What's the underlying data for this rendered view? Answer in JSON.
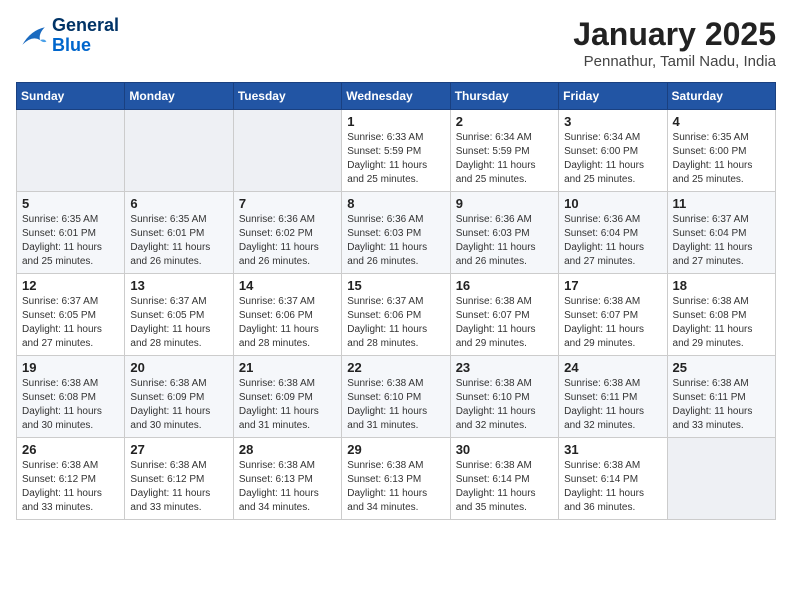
{
  "logo": {
    "line1": "General",
    "line2": "Blue"
  },
  "calendar": {
    "title": "January 2025",
    "subtitle": "Pennathur, Tamil Nadu, India"
  },
  "weekdays": [
    "Sunday",
    "Monday",
    "Tuesday",
    "Wednesday",
    "Thursday",
    "Friday",
    "Saturday"
  ],
  "weeks": [
    [
      {
        "day": "",
        "info": ""
      },
      {
        "day": "",
        "info": ""
      },
      {
        "day": "",
        "info": ""
      },
      {
        "day": "1",
        "info": "Sunrise: 6:33 AM\nSunset: 5:59 PM\nDaylight: 11 hours and 25 minutes."
      },
      {
        "day": "2",
        "info": "Sunrise: 6:34 AM\nSunset: 5:59 PM\nDaylight: 11 hours and 25 minutes."
      },
      {
        "day": "3",
        "info": "Sunrise: 6:34 AM\nSunset: 6:00 PM\nDaylight: 11 hours and 25 minutes."
      },
      {
        "day": "4",
        "info": "Sunrise: 6:35 AM\nSunset: 6:00 PM\nDaylight: 11 hours and 25 minutes."
      }
    ],
    [
      {
        "day": "5",
        "info": "Sunrise: 6:35 AM\nSunset: 6:01 PM\nDaylight: 11 hours and 25 minutes."
      },
      {
        "day": "6",
        "info": "Sunrise: 6:35 AM\nSunset: 6:01 PM\nDaylight: 11 hours and 26 minutes."
      },
      {
        "day": "7",
        "info": "Sunrise: 6:36 AM\nSunset: 6:02 PM\nDaylight: 11 hours and 26 minutes."
      },
      {
        "day": "8",
        "info": "Sunrise: 6:36 AM\nSunset: 6:03 PM\nDaylight: 11 hours and 26 minutes."
      },
      {
        "day": "9",
        "info": "Sunrise: 6:36 AM\nSunset: 6:03 PM\nDaylight: 11 hours and 26 minutes."
      },
      {
        "day": "10",
        "info": "Sunrise: 6:36 AM\nSunset: 6:04 PM\nDaylight: 11 hours and 27 minutes."
      },
      {
        "day": "11",
        "info": "Sunrise: 6:37 AM\nSunset: 6:04 PM\nDaylight: 11 hours and 27 minutes."
      }
    ],
    [
      {
        "day": "12",
        "info": "Sunrise: 6:37 AM\nSunset: 6:05 PM\nDaylight: 11 hours and 27 minutes."
      },
      {
        "day": "13",
        "info": "Sunrise: 6:37 AM\nSunset: 6:05 PM\nDaylight: 11 hours and 28 minutes."
      },
      {
        "day": "14",
        "info": "Sunrise: 6:37 AM\nSunset: 6:06 PM\nDaylight: 11 hours and 28 minutes."
      },
      {
        "day": "15",
        "info": "Sunrise: 6:37 AM\nSunset: 6:06 PM\nDaylight: 11 hours and 28 minutes."
      },
      {
        "day": "16",
        "info": "Sunrise: 6:38 AM\nSunset: 6:07 PM\nDaylight: 11 hours and 29 minutes."
      },
      {
        "day": "17",
        "info": "Sunrise: 6:38 AM\nSunset: 6:07 PM\nDaylight: 11 hours and 29 minutes."
      },
      {
        "day": "18",
        "info": "Sunrise: 6:38 AM\nSunset: 6:08 PM\nDaylight: 11 hours and 29 minutes."
      }
    ],
    [
      {
        "day": "19",
        "info": "Sunrise: 6:38 AM\nSunset: 6:08 PM\nDaylight: 11 hours and 30 minutes."
      },
      {
        "day": "20",
        "info": "Sunrise: 6:38 AM\nSunset: 6:09 PM\nDaylight: 11 hours and 30 minutes."
      },
      {
        "day": "21",
        "info": "Sunrise: 6:38 AM\nSunset: 6:09 PM\nDaylight: 11 hours and 31 minutes."
      },
      {
        "day": "22",
        "info": "Sunrise: 6:38 AM\nSunset: 6:10 PM\nDaylight: 11 hours and 31 minutes."
      },
      {
        "day": "23",
        "info": "Sunrise: 6:38 AM\nSunset: 6:10 PM\nDaylight: 11 hours and 32 minutes."
      },
      {
        "day": "24",
        "info": "Sunrise: 6:38 AM\nSunset: 6:11 PM\nDaylight: 11 hours and 32 minutes."
      },
      {
        "day": "25",
        "info": "Sunrise: 6:38 AM\nSunset: 6:11 PM\nDaylight: 11 hours and 33 minutes."
      }
    ],
    [
      {
        "day": "26",
        "info": "Sunrise: 6:38 AM\nSunset: 6:12 PM\nDaylight: 11 hours and 33 minutes."
      },
      {
        "day": "27",
        "info": "Sunrise: 6:38 AM\nSunset: 6:12 PM\nDaylight: 11 hours and 33 minutes."
      },
      {
        "day": "28",
        "info": "Sunrise: 6:38 AM\nSunset: 6:13 PM\nDaylight: 11 hours and 34 minutes."
      },
      {
        "day": "29",
        "info": "Sunrise: 6:38 AM\nSunset: 6:13 PM\nDaylight: 11 hours and 34 minutes."
      },
      {
        "day": "30",
        "info": "Sunrise: 6:38 AM\nSunset: 6:14 PM\nDaylight: 11 hours and 35 minutes."
      },
      {
        "day": "31",
        "info": "Sunrise: 6:38 AM\nSunset: 6:14 PM\nDaylight: 11 hours and 36 minutes."
      },
      {
        "day": "",
        "info": ""
      }
    ]
  ]
}
